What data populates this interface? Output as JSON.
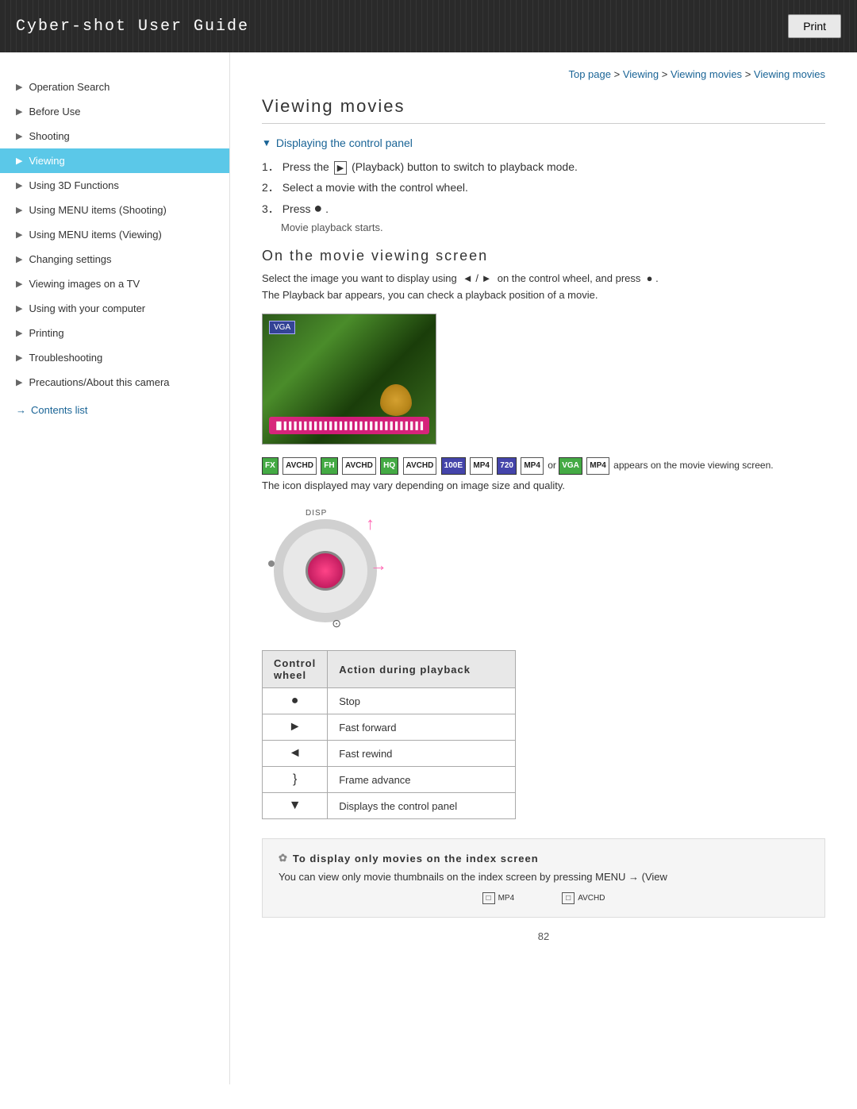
{
  "header": {
    "title": "Cyber-shot User Guide",
    "print_label": "Print"
  },
  "breadcrumb": {
    "items": [
      "Top page",
      "Viewing",
      "Viewing movies",
      "Viewing movies"
    ],
    "separator": " > "
  },
  "sidebar": {
    "items": [
      {
        "label": "Operation Search",
        "active": false
      },
      {
        "label": "Before Use",
        "active": false
      },
      {
        "label": "Shooting",
        "active": false
      },
      {
        "label": "Viewing",
        "active": true
      },
      {
        "label": "Using 3D Functions",
        "active": false
      },
      {
        "label": "Using MENU items (Shooting)",
        "active": false
      },
      {
        "label": "Using MENU items (Viewing)",
        "active": false
      },
      {
        "label": "Changing settings",
        "active": false
      },
      {
        "label": "Viewing images on a TV",
        "active": false
      },
      {
        "label": "Using with your computer",
        "active": false
      },
      {
        "label": "Printing",
        "active": false
      },
      {
        "label": "Troubleshooting",
        "active": false
      },
      {
        "label": "Precautions/About this camera",
        "active": false
      }
    ],
    "contents_link": "Contents list"
  },
  "main": {
    "page_title": "Viewing movies",
    "section_control_panel": {
      "heading": "Displaying the control panel"
    },
    "steps": [
      {
        "num": "1.",
        "text": "Press the  (Playback) button to switch to playback mode."
      },
      {
        "num": "2.",
        "text": "Select a movie with the control wheel."
      },
      {
        "num": "3.",
        "text": "Press  ."
      },
      {
        "indent": "Movie playback starts."
      }
    ],
    "viewing_screen_title": "On the movie viewing screen",
    "viewing_screen_text": "Select the image you want to display using  ◄ / ►  on the control wheel, and press  ●  .",
    "viewing_screen_text2": "The Playback bar appears, you can check a playback position of a movie.",
    "badge_text": " appears on the movie viewing screen.",
    "badge_text2": "The icon displayed may vary depending on image size and quality.",
    "table": {
      "col1": "Control wheel",
      "col2": "Action during playback",
      "rows": [
        {
          "symbol": "●",
          "action": "Stop"
        },
        {
          "symbol": "►",
          "action": "Fast forward"
        },
        {
          "symbol": "◄",
          "action": "Fast rewind"
        },
        {
          "symbol": "}",
          "action": "Frame advance"
        },
        {
          "symbol": "▼",
          "action": "Displays the control panel"
        }
      ]
    },
    "tip": {
      "title": "To display only movies on the index screen",
      "text": "You can view only movie thumbnails on the index screen by pressing MENU →  (View"
    },
    "sub_icons": [
      {
        "label": "MP4"
      },
      {
        "label": "AVCHD"
      }
    ],
    "page_number": "82"
  }
}
